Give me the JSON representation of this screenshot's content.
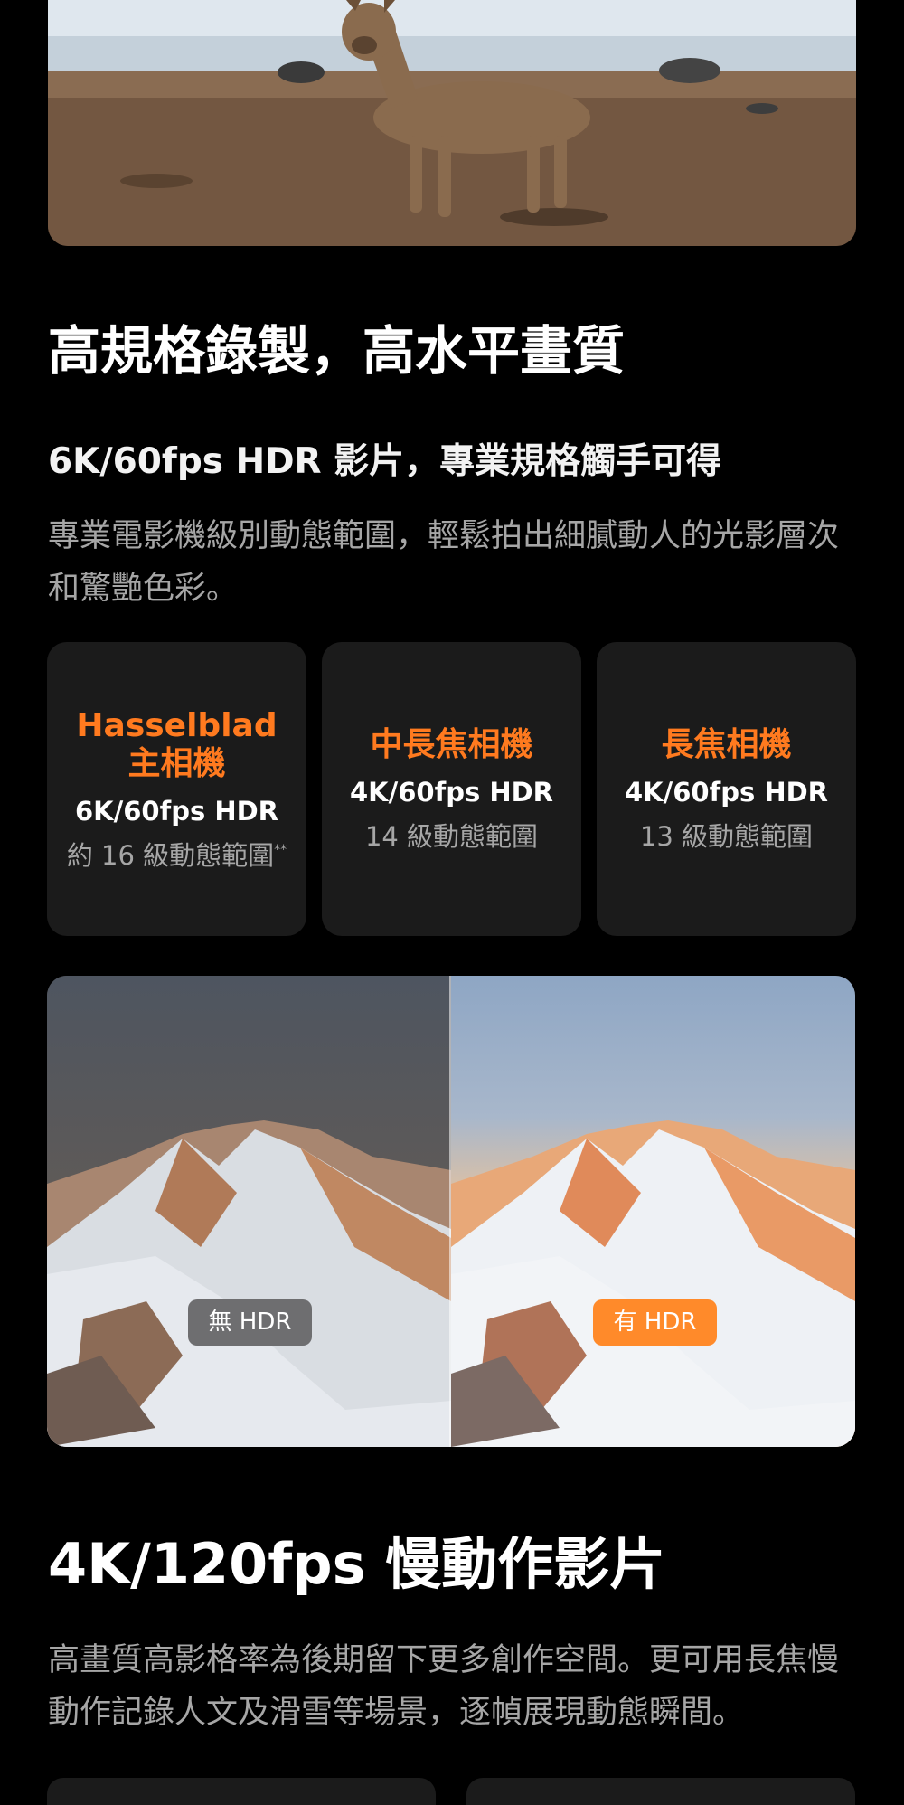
{
  "hdr_section": {
    "title": "高規格錄製，高水平畫質",
    "subtitle": "6K/60fps HDR 影片，專業規格觸手可得",
    "description": "專業電影機級別動態範圍，輕鬆拍出細膩動人的光影層次和驚艷色彩。"
  },
  "cameras": [
    {
      "name": "Hasselblad 主相機",
      "spec": "6K/60fps HDR",
      "range": "約 16 級動態範圍",
      "footnote": "**"
    },
    {
      "name": "中長焦相機",
      "spec": "4K/60fps HDR",
      "range": "14 級動態範圍"
    },
    {
      "name": "長焦相機",
      "spec": "4K/60fps HDR",
      "range": "13 級動態範圍"
    }
  ],
  "hdr_compare": {
    "label_off": "無 HDR",
    "label_on": "有 HDR"
  },
  "slowmo_section": {
    "title": "4K/120fps 慢動作影片",
    "description": "高畫質高影格率為後期留下更多創作空間。更可用長焦慢動作記錄人文及滑雪等場景，逐幀展現動態瞬間。"
  },
  "colors": {
    "background": "#000000",
    "card_background": "#1b1b1b",
    "accent_orange": "#ff7a1f",
    "hdr_on_label": "#ff8a2a",
    "hdr_off_label": "#6e6e70",
    "muted_text": "#a6a6a6"
  }
}
